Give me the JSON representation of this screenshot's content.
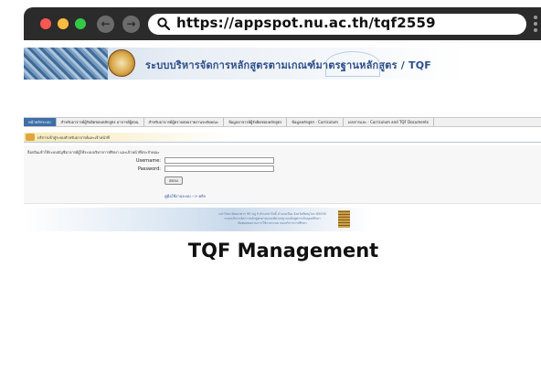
{
  "browser": {
    "url": "https://appspot.nu.ac.th/tqf2559",
    "back_icon": "arrow-left-icon",
    "forward_icon": "arrow-right-icon",
    "search_icon": "search-icon",
    "menu_icon": "kebab-menu-icon",
    "traffic_lights": {
      "close": "#fc5753",
      "minimize": "#fdbc40",
      "maximize": "#33c748"
    }
  },
  "site": {
    "banner_title": "ระบบบริหารจัดการหลักสูตรตามเกณฑ์มาตรฐานหลักสูตร / TQF",
    "menu": [
      "หน้าหลักระบบ",
      "สำหรับอาจารย์ผู้รับผิดชอบหลักสูตร อาจารย์ผู้สอน",
      "สำหรับอาจารย์ผู้ตรวจสอบรายงานระดับคณะ",
      "ข้อมูลอาจารย์ผู้รับผิดชอบหลักสูตร",
      "ข้อมูลหลักสูตร · Curriculum",
      "เอกสารและ · Curriculum and TQF Documents"
    ],
    "page_heading": "บริการเข้าสู่ระบบสำหรับอาจารย์และเจ้าหน้าที่",
    "login": {
      "intro": "ล็อกอินเข้าใช้ระบบบัญชีอาจารย์ผู้ใช้ระบบบริหารการศึกษา และเจ้าหน้าที่ประจำคณะ",
      "username_label": "Username:",
      "password_label": "Password:",
      "submit_label": "ตกลง",
      "manual_link": "คู่มือใช้งานระบบ --> คลิก"
    },
    "footer": {
      "line1": "มหาวิทยาลัยนเรศวร 99 หมู่ 9 ตำบลท่าโพธิ์ อำเภอเมือง จังหวัดพิษณุโลก 65000",
      "line2": "ระบบบริหารจัดการหลักสูตรตามเกณฑ์มาตรฐานหลักสูตรระดับอุดมศึกษา",
      "line3": "ติดต่อสอบถามการใช้งานระบบ กองบริการการศึกษา"
    }
  },
  "caption": "TQF Management"
}
